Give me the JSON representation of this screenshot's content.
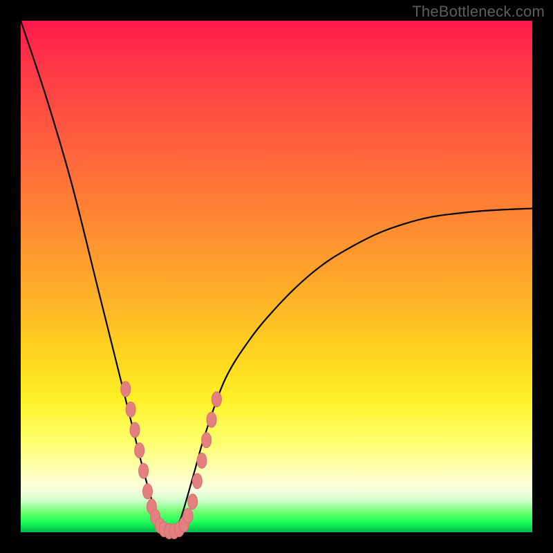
{
  "watermark": "TheBottleneck.com",
  "colors": {
    "frame": "#000000",
    "curve": "#000000",
    "marker_fill": "#e48080",
    "marker_stroke": "#d46e6e"
  },
  "chart_data": {
    "type": "line",
    "title": "",
    "xlabel": "",
    "ylabel": "",
    "axes_visible": false,
    "xlim": [
      0,
      100
    ],
    "ylim": [
      0,
      100
    ],
    "series": [
      {
        "name": "bottleneck-curve",
        "description": "V-shaped bottleneck curve; minimum (0) near x≈29, rising steeply to 100 at x=0 and toward ~63 at x=100.",
        "x": [
          0,
          5,
          10,
          15,
          18,
          20,
          22,
          24,
          26,
          27,
          28,
          29,
          30,
          31,
          32,
          34,
          36,
          40,
          45,
          50,
          55,
          60,
          65,
          70,
          75,
          80,
          85,
          90,
          95,
          100
        ],
        "values": [
          100,
          85,
          68,
          48,
          36,
          28,
          20,
          12,
          5,
          2,
          0.5,
          0,
          0.5,
          2,
          5,
          12,
          19,
          30,
          38,
          44,
          49,
          53,
          56,
          58.5,
          60.3,
          61.6,
          62.3,
          62.8,
          63.1,
          63.3
        ]
      }
    ],
    "markers": {
      "name": "highlighted-points",
      "description": "Pink oval markers clustered near the curve minimum on both branches and along the flat bottom.",
      "points_xy": [
        [
          20.5,
          28
        ],
        [
          21.5,
          24
        ],
        [
          22.3,
          20
        ],
        [
          23.2,
          16
        ],
        [
          24.0,
          12
        ],
        [
          24.8,
          8
        ],
        [
          25.6,
          5
        ],
        [
          26.3,
          3
        ],
        [
          27.2,
          1.3
        ],
        [
          28.0,
          0.6
        ],
        [
          29.0,
          0.2
        ],
        [
          30.0,
          0.2
        ],
        [
          31.0,
          0.6
        ],
        [
          31.9,
          1.5
        ],
        [
          32.7,
          3.2
        ],
        [
          33.6,
          6
        ],
        [
          34.5,
          10
        ],
        [
          35.4,
          14
        ],
        [
          36.3,
          18
        ],
        [
          37.3,
          22
        ],
        [
          38.3,
          26
        ]
      ]
    }
  }
}
